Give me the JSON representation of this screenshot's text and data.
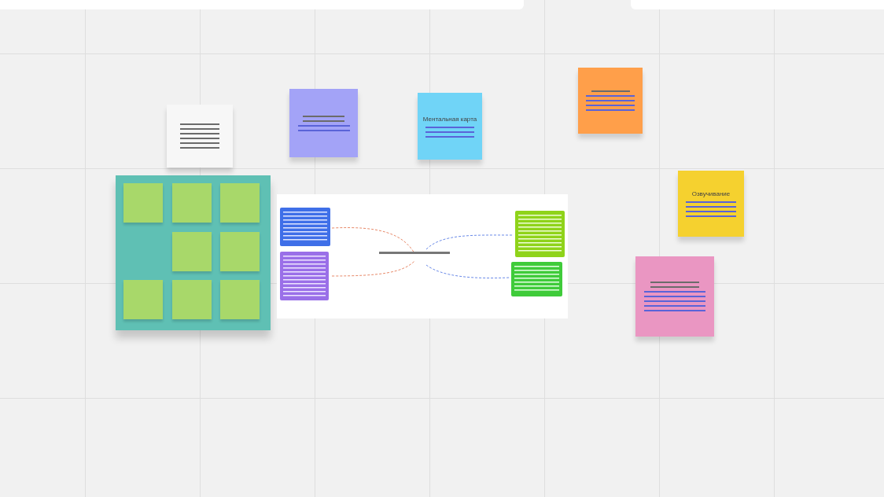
{
  "notes": [
    {
      "kind": "text",
      "color": "#f7f7f7"
    },
    {
      "kind": "text",
      "color": "#a3a3f7"
    },
    {
      "kind": "titled",
      "color": "#70d4f7",
      "title": "Ментальная карта"
    },
    {
      "kind": "text",
      "color": "#ff9f4a"
    },
    {
      "kind": "titled",
      "color": "#f5d12f",
      "title": "Озвучивание"
    },
    {
      "kind": "text",
      "color": "#ea96c2"
    }
  ],
  "frame": {
    "color": "#5fc0b4",
    "slots": [
      {
        "kind": "note"
      },
      {
        "kind": "note"
      },
      {
        "kind": "note"
      },
      {
        "kind": "empty"
      },
      {
        "kind": "note"
      },
      {
        "kind": "note"
      },
      {
        "kind": "note"
      },
      {
        "kind": "note"
      },
      {
        "kind": "note"
      }
    ]
  }
}
